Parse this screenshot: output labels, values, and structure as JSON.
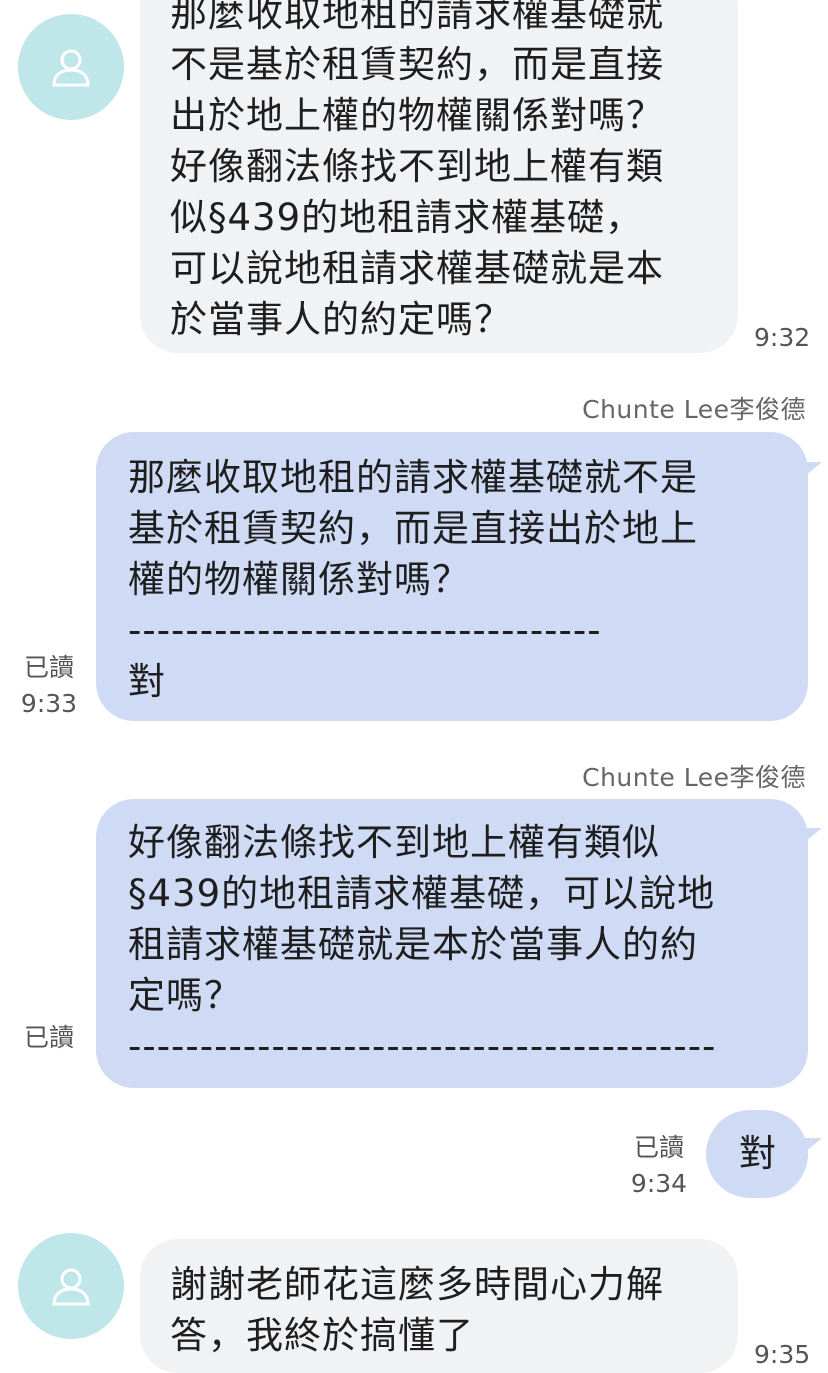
{
  "messages": [
    {
      "text": "那麼收取地租的請求權基礎就\n不是基於租賃契約，而是直接\n出於地上權的物權關係對嗎？\n好像翻法條找不到地上權有類\n似§439的地租請求權基礎，\n可以說地租請求權基礎就是本\n於當事人的約定嗎？",
      "time": "9:32"
    },
    {
      "sender": "Chunte  Lee李俊德",
      "text": "那麼收取地租的請求權基礎就不是\n基於租賃契約，而是直接出於地上\n權的物權關係對嗎？\n---------------------------------\n對",
      "read": "已讀",
      "time": "9:33"
    },
    {
      "sender": "Chunte  Lee李俊德",
      "text": "好像翻法條找不到地上權有類似\n§439的地租請求權基礎，可以說地\n租請求權基礎就是本於當事人的約\n定嗎？\n-----------------------------------------",
      "read": "已讀"
    },
    {
      "text": "對",
      "read": "已讀",
      "time": "9:34"
    },
    {
      "text": "謝謝老師花這麼多時間心力解\n答，我終於搞懂了",
      "time": "9:35"
    }
  ],
  "colors": {
    "incoming_bubble": "#f1f2f4",
    "outgoing_bubble": "#cfdaf4",
    "avatar_bg": "#bfe7e9"
  }
}
